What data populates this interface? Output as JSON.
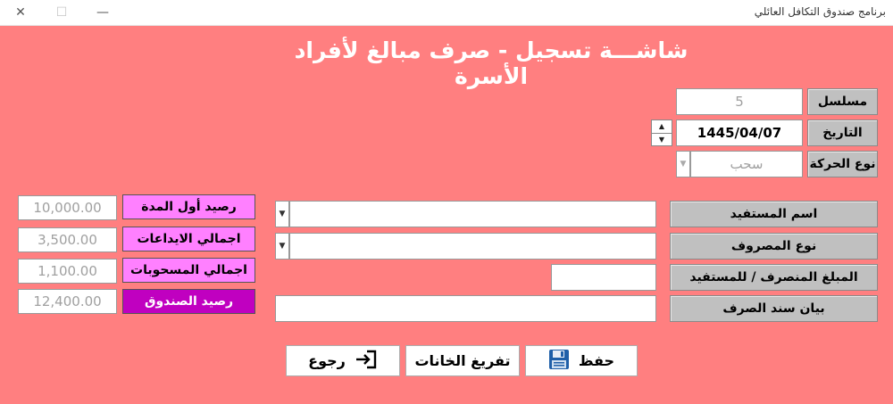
{
  "window": {
    "title": "برنامج صندوق التكافل العائلي",
    "close": "✕",
    "maximize": "☐",
    "minimize": "—"
  },
  "heading": "شاشـــة تسجيل - صرف مبالغ لأفراد الأسرة",
  "top": {
    "serial_label": "مسلسل",
    "serial_value": "5",
    "date_label": "التاريخ",
    "date_value": "1445/04/07",
    "movement_label": "نوع الحركة",
    "movement_value": "سحب"
  },
  "form": {
    "beneficiary_label": "اسم المستفيد",
    "beneficiary_value": "",
    "expense_type_label": "نوع المصروف",
    "expense_type_value": "",
    "amount_label": "المبلغ المنصرف / للمستفيد",
    "amount_value": "",
    "statement_label": "بيان سند الصرف",
    "statement_value": ""
  },
  "summary": {
    "opening_label": "رصيد أول المدة",
    "opening_value": "10,000.00",
    "deposits_label": "اجمالي الايداعات",
    "deposits_value": "3,500.00",
    "withdrawals_label": "اجمالي المسحوبات",
    "withdrawals_value": "1,100.00",
    "balance_label": "رصيد الصندوق",
    "balance_value": "12,400.00"
  },
  "buttons": {
    "save": "حفظ",
    "clear": "تفريغ الخانات",
    "back": "رجوع"
  },
  "icons": {
    "save": "floppy-disk-icon",
    "back": "exit-door-icon",
    "dropdown": "triangle-down-icon",
    "spin_up": "triangle-up-icon",
    "spin_down": "triangle-down-icon"
  },
  "colors": {
    "background": "#ff7f80",
    "label_gray": "#c0c0c0",
    "pink": "#ff80ff",
    "purple": "#c000c0"
  }
}
